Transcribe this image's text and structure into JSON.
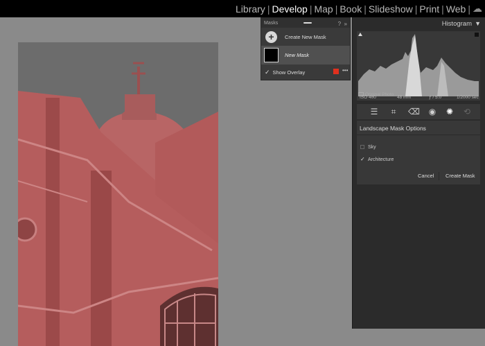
{
  "modules": {
    "items": [
      "Library",
      "Develop",
      "Map",
      "Book",
      "Slideshow",
      "Print",
      "Web"
    ],
    "active": "Develop",
    "cloud_icon": "cloud-icon"
  },
  "masks_panel": {
    "title": "Masks",
    "create_label": "Create New Mask",
    "mask_name": "New Mask",
    "show_overlay_label": "Show Overlay",
    "overlay_checked": true,
    "overlay_color": "#e0301e",
    "help_icon": "?",
    "collapse_icon": "»"
  },
  "histogram": {
    "title": "Histogram",
    "iso": "ISO 400",
    "focal": "48 mm",
    "aperture": "ƒ / 5.0",
    "shutter": "1/2000 sec",
    "original_photo": "Original Photo"
  },
  "tools": [
    "sliders-icon",
    "crop-icon",
    "heal-icon",
    "redeye-icon",
    "masking-icon",
    "settings-icon"
  ],
  "landscape_options": {
    "title": "Landscape Mask Options",
    "options": [
      {
        "label": "Sky",
        "checked": false
      },
      {
        "label": "Architecture",
        "checked": true
      }
    ],
    "cancel_label": "Cancel",
    "create_label": "Create Mask"
  },
  "colors": {
    "overlay_red": "#c84848",
    "sky_gray": "#6a6a6a"
  }
}
